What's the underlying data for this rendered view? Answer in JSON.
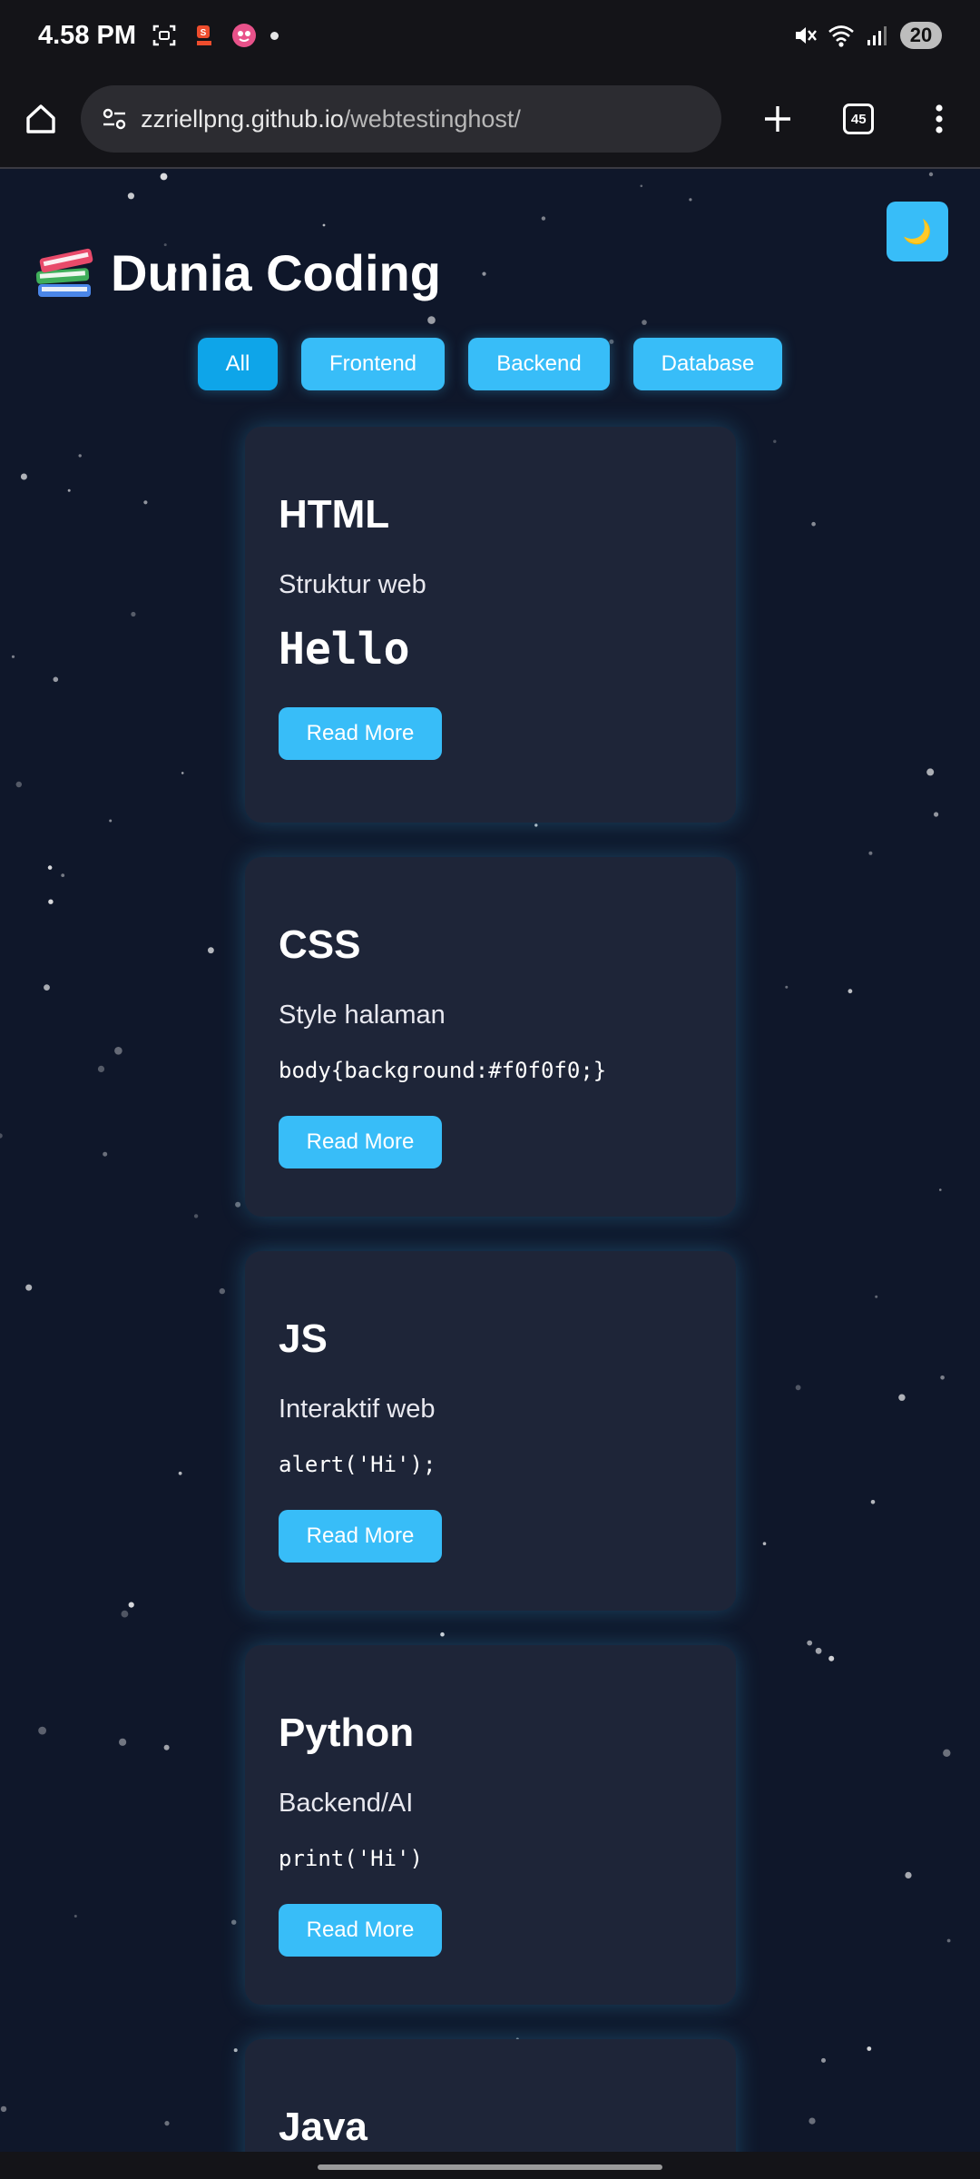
{
  "status_bar": {
    "time": "4.58 PM",
    "battery": "20",
    "icons": [
      "screenshot-icon",
      "shopeepay-icon",
      "app-icon",
      "notification-dot",
      "mute-icon",
      "wifi-icon",
      "signal-icon",
      "battery-icon"
    ]
  },
  "browser": {
    "url_host": "zzriellpng.github.io",
    "url_path": "/webtestinghost/",
    "tab_count": "45"
  },
  "page": {
    "theme_toggle": "🌙",
    "title": "Dunia Coding",
    "filters": [
      "All",
      "Frontend",
      "Backend",
      "Database"
    ],
    "active_filter": "All",
    "cards": [
      {
        "title": "HTML",
        "desc": "Struktur web",
        "code": "Hello",
        "button": "Read More"
      },
      {
        "title": "CSS",
        "desc": "Style halaman",
        "code": "body{background:#f0f0f0;}",
        "button": "Read More"
      },
      {
        "title": "JS",
        "desc": "Interaktif web",
        "code": "alert('Hi');",
        "button": "Read More"
      },
      {
        "title": "Python",
        "desc": "Backend/AI",
        "code": "print('Hi')",
        "button": "Read More"
      },
      {
        "title": "Java"
      }
    ]
  },
  "colors": {
    "page_bg": "#0f172a",
    "card_bg": "#1e2538",
    "accent": "#38bdf8",
    "accent_active": "#0ea5e9",
    "chrome_bg": "#141418"
  }
}
